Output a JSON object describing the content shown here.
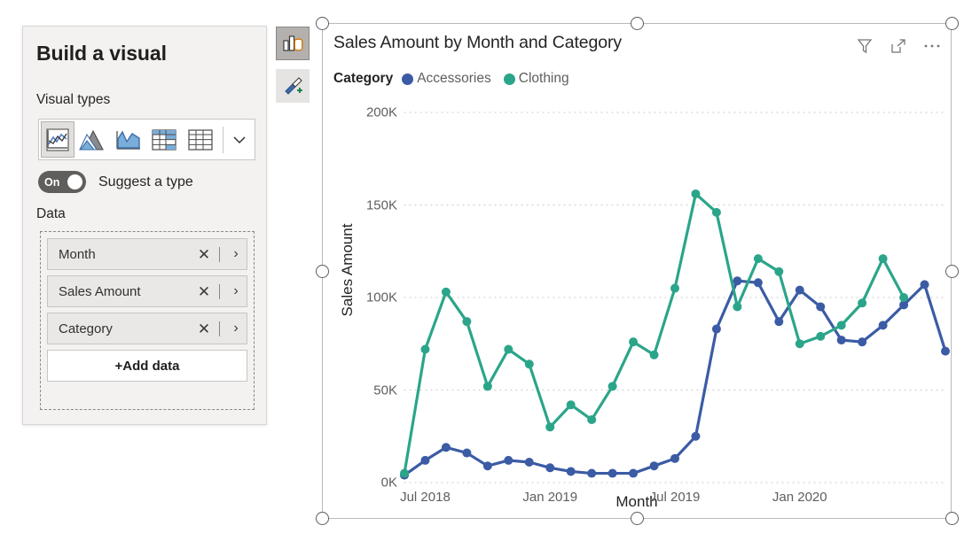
{
  "build_panel": {
    "title": "Build a visual",
    "visual_types_label": "Visual types",
    "visual_type_icons": [
      {
        "name": "line-and-stacked-column-chart-icon",
        "selected": true
      },
      {
        "name": "stacked-area-chart-icon",
        "selected": false
      },
      {
        "name": "area-chart-icon",
        "selected": false
      },
      {
        "name": "matrix-table-icon",
        "selected": false
      },
      {
        "name": "table-icon",
        "selected": false
      }
    ],
    "gallery_expand_icon": "chevron-down-icon",
    "suggest": {
      "toggle_state": "On",
      "label": "Suggest a type"
    },
    "data_label": "Data",
    "fields": [
      {
        "label": "Month",
        "remove_icon": "close-icon",
        "expand_icon": "chevron-right-icon"
      },
      {
        "label": "Sales Amount",
        "remove_icon": "close-icon",
        "expand_icon": "chevron-right-icon"
      },
      {
        "label": "Category",
        "remove_icon": "close-icon",
        "expand_icon": "chevron-right-icon"
      }
    ],
    "add_data_label": "+Add data"
  },
  "mini_toolbar": {
    "build_icon": "build-visual-icon",
    "format_icon": "format-paintbrush-icon"
  },
  "visual": {
    "title": "Sales Amount by Month and Category",
    "header_icons": [
      {
        "name": "filter-icon"
      },
      {
        "name": "focus-mode-icon"
      },
      {
        "name": "more-options-icon"
      }
    ]
  },
  "chart_data": {
    "type": "line",
    "title": "Sales Amount by Month and Category",
    "xlabel": "Month",
    "ylabel": "Sales Amount",
    "legend_title": "Category",
    "legend_position": "top",
    "grid": true,
    "ylim": [
      0,
      200000
    ],
    "yticks": [
      0,
      50000,
      100000,
      150000,
      200000
    ],
    "ytick_labels": [
      "0K",
      "50K",
      "100K",
      "150K",
      "200K"
    ],
    "xtick_labels": [
      "Jul 2018",
      "Jan 2019",
      "Jul 2019",
      "Jan 2020"
    ],
    "xtick_indices": [
      1,
      7,
      13,
      19
    ],
    "x": [
      "Jun 2018",
      "Jul 2018",
      "Aug 2018",
      "Sep 2018",
      "Oct 2018",
      "Nov 2018",
      "Dec 2018",
      "Jan 2019",
      "Feb 2019",
      "Mar 2019",
      "Apr 2019",
      "May 2019",
      "Jun 2019",
      "Jul 2019",
      "Aug 2019",
      "Sep 2019",
      "Oct 2019",
      "Nov 2019",
      "Dec 2019",
      "Jan 2020",
      "Feb 2020",
      "Mar 2020",
      "Apr 2020",
      "May 2020",
      "Jun 2020"
    ],
    "series": [
      {
        "name": "Accessories",
        "color": "#3B5BA5",
        "values": [
          4000,
          12000,
          19000,
          16000,
          9000,
          12000,
          11000,
          8000,
          6000,
          5000,
          5000,
          5000,
          9000,
          13000,
          25000,
          83000,
          109000,
          108000,
          87000,
          104000,
          95000,
          77000,
          76000,
          85000,
          96000,
          107000,
          71000
        ]
      },
      {
        "name": "Clothing",
        "color": "#2BA58A",
        "values": [
          5000,
          72000,
          103000,
          87000,
          52000,
          72000,
          64000,
          30000,
          42000,
          34000,
          52000,
          76000,
          69000,
          105000,
          156000,
          146000,
          95000,
          121000,
          114000,
          75000,
          79000,
          85000,
          97000,
          121000,
          100000
        ]
      }
    ],
    "series_accessories_count": 27,
    "series_clothing_count": 25
  }
}
